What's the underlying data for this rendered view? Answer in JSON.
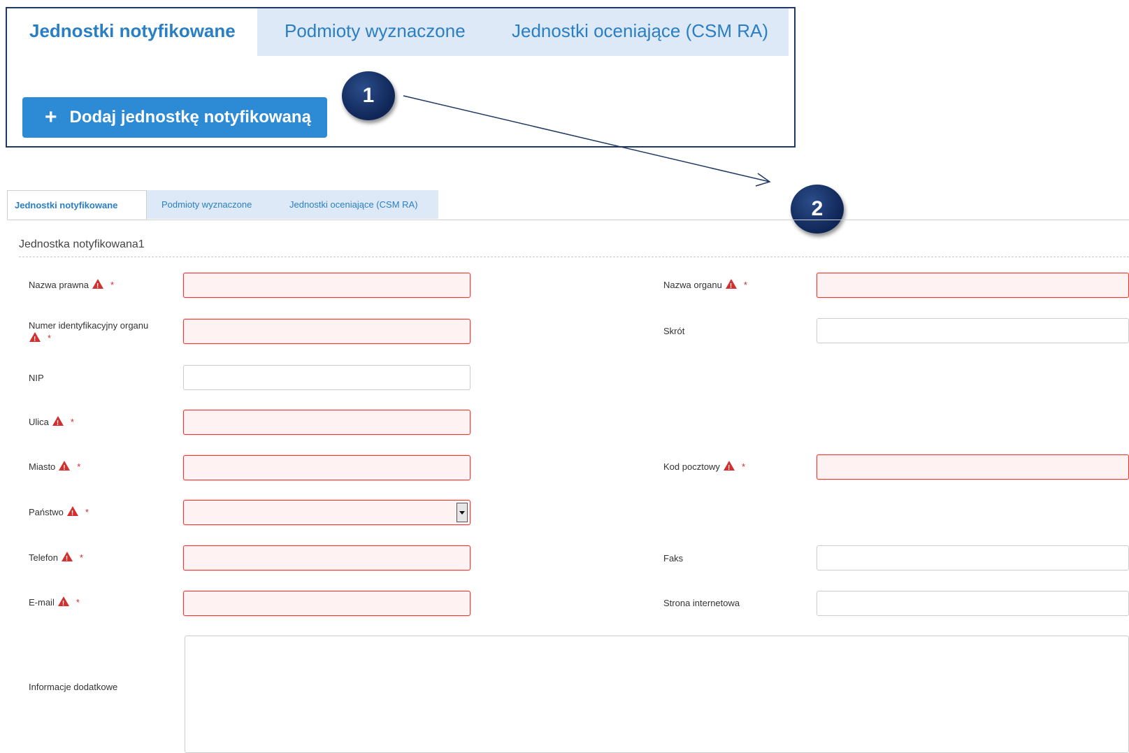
{
  "top_panel": {
    "tabs": [
      "Jednostki notyfikowane",
      "Podmioty wyznaczone",
      "Jednostki oceniające (CSM RA)"
    ],
    "add_button": "Dodaj jednostkę notyfikowaną",
    "add_icon": "+"
  },
  "callouts": [
    "1",
    "2"
  ],
  "form": {
    "tabs": [
      "Jednostki notyfikowane",
      "Podmioty wyznaczone",
      "Jednostki oceniające (CSM RA)"
    ],
    "section_title": "Jednostka notyfikowana1",
    "required_marker": "*",
    "labels": {
      "nazwa_prawna": "Nazwa prawna",
      "nazwa_organu": "Nazwa organu",
      "numer_id": "Numer identyfikacyjny organu",
      "skrot": "Skrót",
      "nip": "NIP",
      "ulica": "Ulica",
      "miasto": "Miasto",
      "kod": "Kod pocztowy",
      "panstwo": "Państwo",
      "telefon": "Telefon",
      "faks": "Faks",
      "email": "E-mail",
      "strona": "Strona internetowa",
      "info": "Informacje dodatkowe"
    }
  },
  "colors": {
    "accent": "#2d8ad4",
    "error": "#e53935",
    "callout": "#0f2556"
  }
}
